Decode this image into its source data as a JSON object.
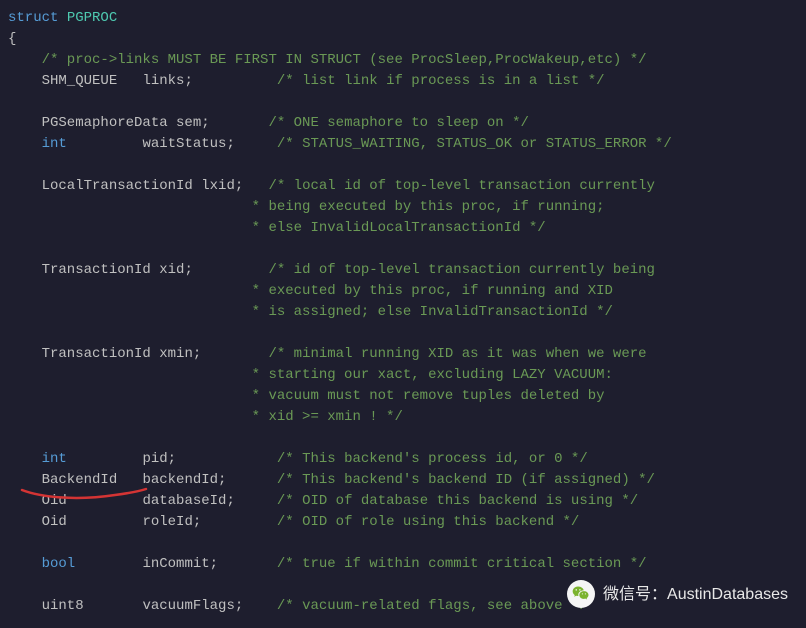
{
  "code": {
    "struct_kw": "struct",
    "struct_name": "PGPROC",
    "open_brace": "{",
    "line_comment_first": "    /* proc->links MUST BE FIRST IN STRUCT (see ProcSleep,ProcWakeup,etc) */",
    "links_type": "    SHM_QUEUE",
    "links_gap": "   ",
    "links_field": "links;",
    "links_pad": "          ",
    "links_comment": "/* list link if process is in a list */",
    "sem_type": "    PGSemaphoreData ",
    "sem_field": "sem;",
    "sem_pad": "       ",
    "sem_comment": "/* ONE semaphore to sleep on */",
    "waitStatus_type": "    int",
    "waitStatus_gap": "         ",
    "waitStatus_field": "waitStatus;",
    "waitStatus_pad": "     ",
    "waitStatus_comment": "/* STATUS_WAITING, STATUS_OK or STATUS_ERROR */",
    "lxid_type": "    LocalTransactionId ",
    "lxid_field": "lxid;",
    "lxid_pad": "   ",
    "lxid_comment1": "/* local id of top-level transaction currently",
    "lxid_comment2": "                             * being executed by this proc, if running;",
    "lxid_comment3": "                             * else InvalidLocalTransactionId */",
    "xid_type": "    TransactionId ",
    "xid_field": "xid;",
    "xid_pad": "         ",
    "xid_comment1": "/* id of top-level transaction currently being",
    "xid_comment2": "                             * executed by this proc, if running and XID",
    "xid_comment3": "                             * is assigned; else InvalidTransactionId */",
    "xmin_type": "    TransactionId ",
    "xmin_field": "xmin;",
    "xmin_pad": "        ",
    "xmin_comment1": "/* minimal running XID as it was when we were",
    "xmin_comment2": "                             * starting our xact, excluding LAZY VACUUM:",
    "xmin_comment3": "                             * vacuum must not remove tuples deleted by",
    "xmin_comment4": "                             * xid >= xmin ! */",
    "pid_type": "    int",
    "pid_gap": "         ",
    "pid_field": "pid;",
    "pid_pad": "            ",
    "pid_comment": "/* This backend's process id, or 0 */",
    "backendId_type": "    BackendId",
    "backendId_gap": "   ",
    "backendId_field": "backendId;",
    "backendId_pad": "      ",
    "backendId_comment": "/* This backend's backend ID (if assigned) */",
    "databaseId_type": "    Oid",
    "databaseId_gap": "         ",
    "databaseId_field": "databaseId;",
    "databaseId_pad": "     ",
    "databaseId_comment": "/* OID of database this backend is using */",
    "roleId_type": "    Oid",
    "roleId_gap": "         ",
    "roleId_field": "roleId;",
    "roleId_pad": "         ",
    "roleId_comment": "/* OID of role using this backend */",
    "inCommit_type": "    bool",
    "inCommit_gap": "        ",
    "inCommit_field": "inCommit;",
    "inCommit_pad": "       ",
    "inCommit_comment": "/* true if within commit critical section */",
    "vacuumFlags_type": "    uint8",
    "vacuumFlags_gap": "       ",
    "vacuumFlags_field": "vacuumFlags;",
    "vacuumFlags_pad": "    ",
    "vacuumFlags_comment": "/* vacuum-related flags, see above */"
  },
  "watermark": {
    "label": "微信号：AustinDatabases"
  }
}
